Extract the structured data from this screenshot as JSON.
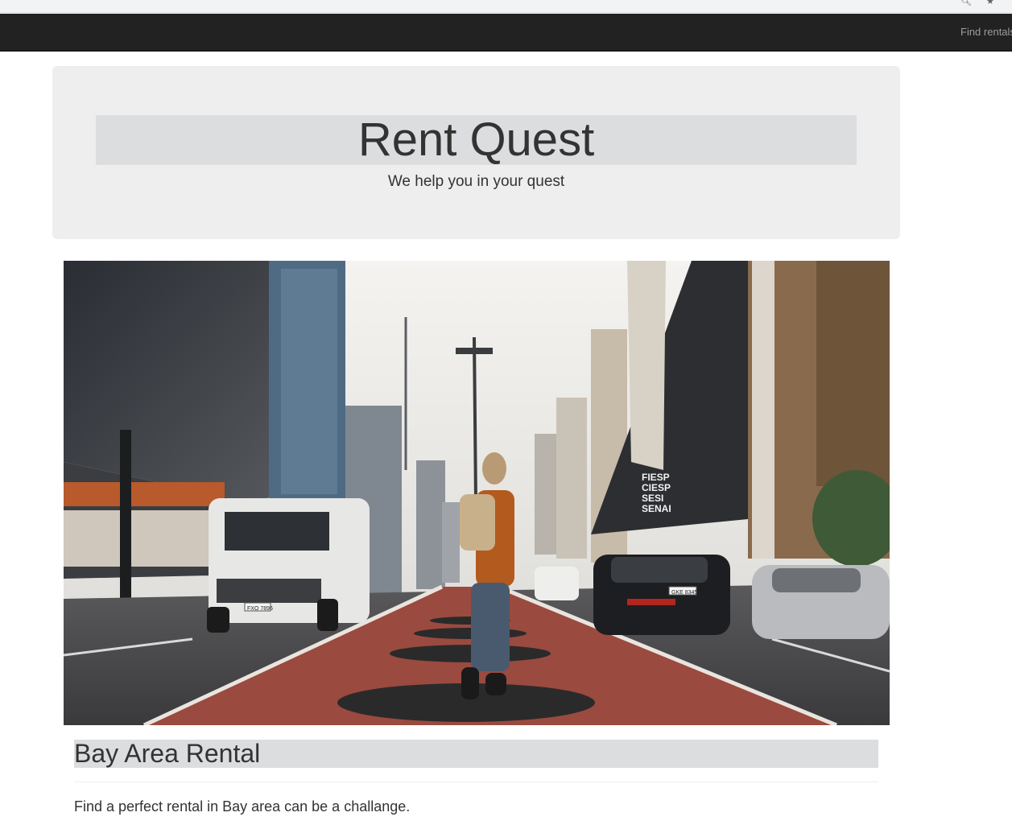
{
  "navbar": {
    "link_label": "Find rentals"
  },
  "jumbotron": {
    "title": "Rent Quest",
    "tagline": "We help you in your quest"
  },
  "hero": {
    "signage_lines": [
      "FIESP",
      "CIESP",
      "SESI",
      "SENAI"
    ],
    "van_plate": "FXO 7896",
    "car_plate": "GKE 8345"
  },
  "section": {
    "title": "Bay Area Rental",
    "intro": "Find a perfect rental in Bay area can be a challange."
  },
  "colors": {
    "navbar_bg": "#222222",
    "jumbotron_bg": "#eeeeee",
    "highlight_band": "#dcdddf",
    "text": "#333333",
    "bike_lane": "#9a4a3f"
  }
}
